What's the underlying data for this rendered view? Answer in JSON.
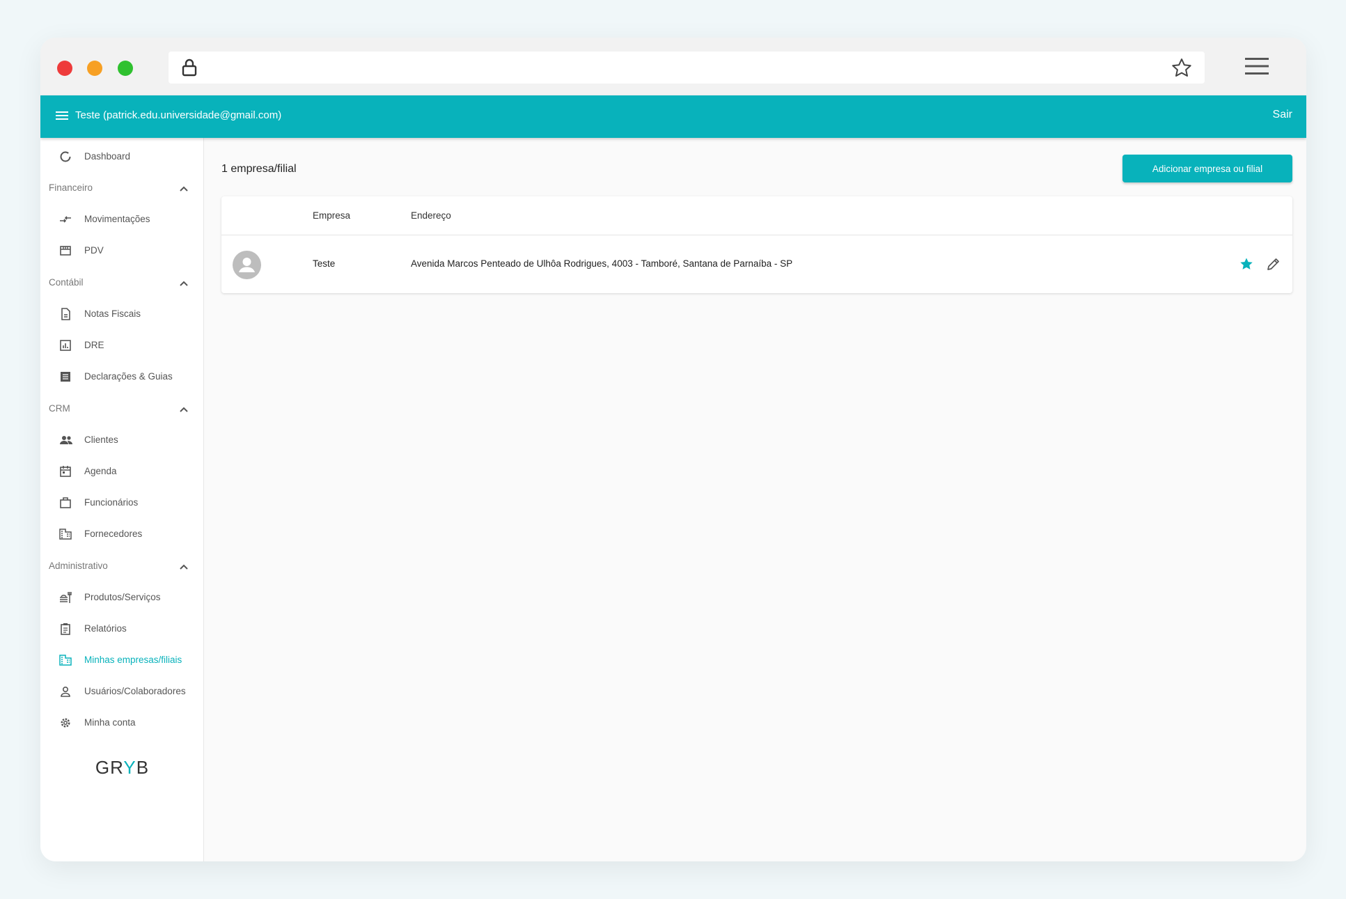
{
  "app": {
    "user_label": "Teste (patrick.edu.universidade@gmail.com)",
    "logout_label": "Sair",
    "brand_prefix": "GR",
    "brand_accent": "Y",
    "brand_suffix": "B"
  },
  "colors": {
    "primary": "#08b2bb",
    "dot_red": "#ee3b3b",
    "dot_orange": "#f7a024",
    "dot_green": "#2fc12f"
  },
  "sidebar": {
    "dashboard": {
      "label": "Dashboard",
      "icon": "donut-icon"
    },
    "financeiro": {
      "label": "Financeiro",
      "items": [
        {
          "label": "Movimentações",
          "icon": "transfer-arrows-icon"
        },
        {
          "label": "PDV",
          "icon": "store-icon"
        }
      ]
    },
    "contabil": {
      "label": "Contábil",
      "items": [
        {
          "label": "Notas Fiscais",
          "icon": "document-icon"
        },
        {
          "label": "DRE",
          "icon": "bar-chart-icon"
        },
        {
          "label": "Declarações & Guias",
          "icon": "list-doc-icon"
        }
      ]
    },
    "crm": {
      "label": "CRM",
      "items": [
        {
          "label": "Clientes",
          "icon": "people-icon"
        },
        {
          "label": "Agenda",
          "icon": "calendar-icon"
        },
        {
          "label": "Funcionários",
          "icon": "briefcase-icon"
        },
        {
          "label": "Fornecedores",
          "icon": "building-icon"
        }
      ]
    },
    "administrativo": {
      "label": "Administrativo",
      "items": [
        {
          "label": "Produtos/Serviços",
          "icon": "products-icon"
        },
        {
          "label": "Relatórios",
          "icon": "clipboard-icon"
        },
        {
          "label": "Minhas empresas/filiais",
          "icon": "building-icon",
          "active": true
        },
        {
          "label": "Usuários/Colaboradores",
          "icon": "user-icon"
        },
        {
          "label": "Minha conta",
          "icon": "gear-icon"
        }
      ]
    }
  },
  "main": {
    "count_label": "1 empresa/filial",
    "add_button_label": "Adicionar empresa ou filial",
    "table": {
      "headers": {
        "empresa": "Empresa",
        "endereco": "Endereço"
      },
      "rows": [
        {
          "empresa": "Teste",
          "endereco": "Avenida Marcos Penteado de Ulhôa Rodrigues, 4003 - Tamboré, Santana de Parnaíba - SP"
        }
      ]
    }
  }
}
